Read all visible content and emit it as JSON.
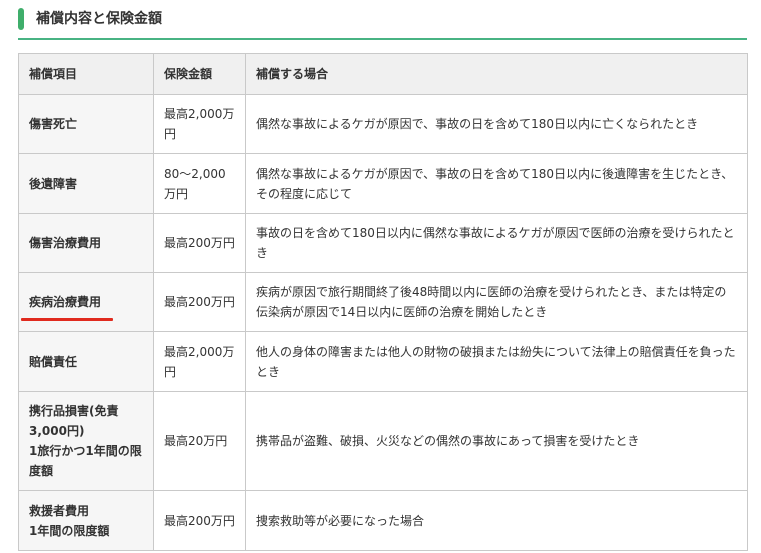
{
  "section": {
    "title": "補償内容と保険金額",
    "accent_color": "#3fae6b",
    "rule_color": "#48b383"
  },
  "table": {
    "headers": [
      "補償項目",
      "保険金額",
      "補償する場合"
    ],
    "rows": [
      {
        "item": "傷害死亡",
        "amount": "最高2,000万円",
        "condition": "偶然な事故によるケガが原因で、事故の日を含めて180日以内に亡くなられたとき"
      },
      {
        "item": "後遺障害",
        "amount": "80〜2,000万円",
        "condition": "偶然な事故によるケガが原因で、事故の日を含めて180日以内に後遺障害を生じたとき、その程度に応じて"
      },
      {
        "item": "傷害治療費用",
        "amount": "最高200万円",
        "condition": "事故の日を含めて180日以内に偶然な事故によるケガが原因で医師の治療を受けられたとき"
      },
      {
        "item": "疾病治療費用",
        "amount": "最高200万円",
        "condition": "疾病が原因で旅行期間終了後48時間以内に医師の治療を受けられたとき、または特定の伝染病が原因で14日以内に医師の治療を開始したとき",
        "underline_color": "#e02a1e"
      },
      {
        "item": "賠償責任",
        "amount": "最高2,000万円",
        "condition": "他人の身体の障害または他人の財物の破損または紛失について法律上の賠償責任を負ったとき"
      },
      {
        "item": "携行品損害(免責3,000円)\n1旅行かつ1年間の限度額",
        "amount": "最高20万円",
        "condition": "携帯品が盗難、破損、火災などの偶然の事故にあって損害を受けたとき"
      },
      {
        "item": "救援者費用\n1年間の限度額",
        "amount": "最高200万円",
        "condition": "捜索救助等が必要になった場合"
      }
    ]
  }
}
